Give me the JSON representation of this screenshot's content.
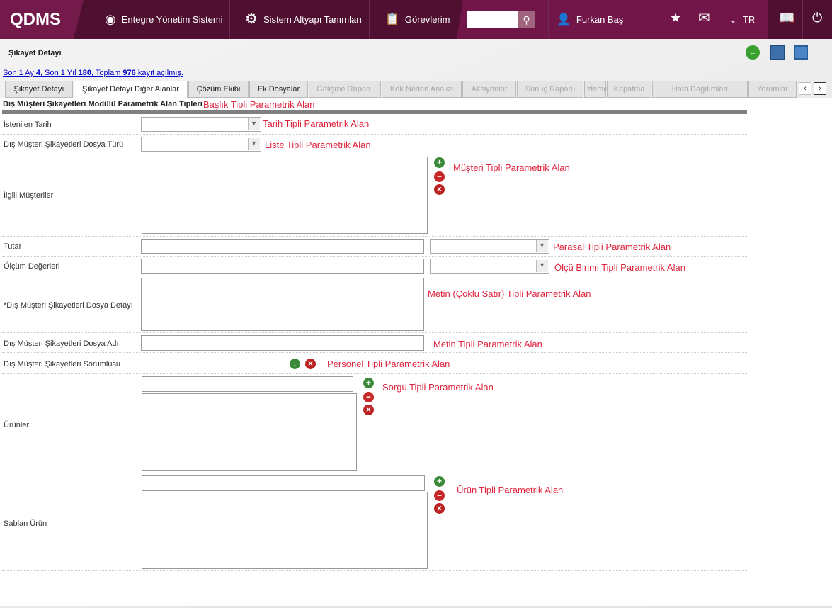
{
  "header": {
    "logo": "QDMS",
    "nav": [
      "Entegre Yönetim Sistemi",
      "Sistem Altyapı Tanımları",
      "Görevlerim"
    ],
    "search_value": "",
    "user": "Furkan Baş",
    "lang": "TR"
  },
  "page": {
    "title": "Şikayet Detayı",
    "stats": {
      "p1": "Son 1 Ay ",
      "v1": "4",
      "p2": ", Son 1 Yıl ",
      "v2": "180",
      "p3": ", Toplam ",
      "v3": "976",
      "p4": " kayıt açılmış."
    }
  },
  "tabs": [
    {
      "label": "Şikayet Detayı",
      "state": "enabled"
    },
    {
      "label": "Şikayet Detayı Diğer Alanlar",
      "state": "active"
    },
    {
      "label": "Çözüm Ekibi",
      "state": "enabled"
    },
    {
      "label": "Ek Dosyalar",
      "state": "enabled"
    },
    {
      "label": "Gelişme Raporu",
      "state": "disabled"
    },
    {
      "label": "Kök Neden Analizi",
      "state": "disabled"
    },
    {
      "label": "Aksiyonlar",
      "state": "disabled"
    },
    {
      "label": "Sonuç Raporu",
      "state": "disabled"
    },
    {
      "label": "İzleme",
      "state": "disabled"
    },
    {
      "label": "Kapatma",
      "state": "disabled"
    },
    {
      "label": "Hata Dağılımları",
      "state": "disabled"
    },
    {
      "label": "Yorumlar",
      "state": "disabled"
    }
  ],
  "section": {
    "title": "Dış Müşteri Şikayetleri Modülü Parametrik Alan Tipleri",
    "annotation": "Başlık Tipli Parametrik Alan"
  },
  "fields": [
    {
      "label": "İstenilen Tarih",
      "annotation": "Tarih Tipli Parametrik Alan"
    },
    {
      "label": "Dış Müşteri Şikayetleri Dosya Türü",
      "annotation": "Liste Tipli Parametrik Alan"
    },
    {
      "label": "İlgili Müşteriler",
      "annotation": "Müşteri Tipli Parametrik Alan"
    },
    {
      "label": "Tutar",
      "annotation": "Parasal Tipli Parametrik Alan"
    },
    {
      "label": "Ölçüm Değerleri",
      "annotation": "Ölçü Birimi Tipli Parametrik Alan"
    },
    {
      "label": "*Dış Müşteri Şikayetleri Dosya Detayı",
      "annotation": "Metin (Çoklu Satır) Tipli Parametrik Alan"
    },
    {
      "label": "Dış Müşteri Şikayetleri Dosya Adı",
      "annotation": "Metin Tipli Parametrik Alan"
    },
    {
      "label": "Dış Müşteri Şikayetleri Sorumlusu",
      "annotation": "Personel Tipli Parametrik Alan"
    },
    {
      "label": "Ürünler",
      "annotation": "Sorgu Tipli Parametrik Alan"
    },
    {
      "label": "Sablan Ürün",
      "annotation": "Ürün Tipli Parametrik Alan"
    }
  ],
  "colors": {
    "header": "#4e0f30",
    "accent": "#731a4b",
    "annotation": "#e0243e"
  }
}
